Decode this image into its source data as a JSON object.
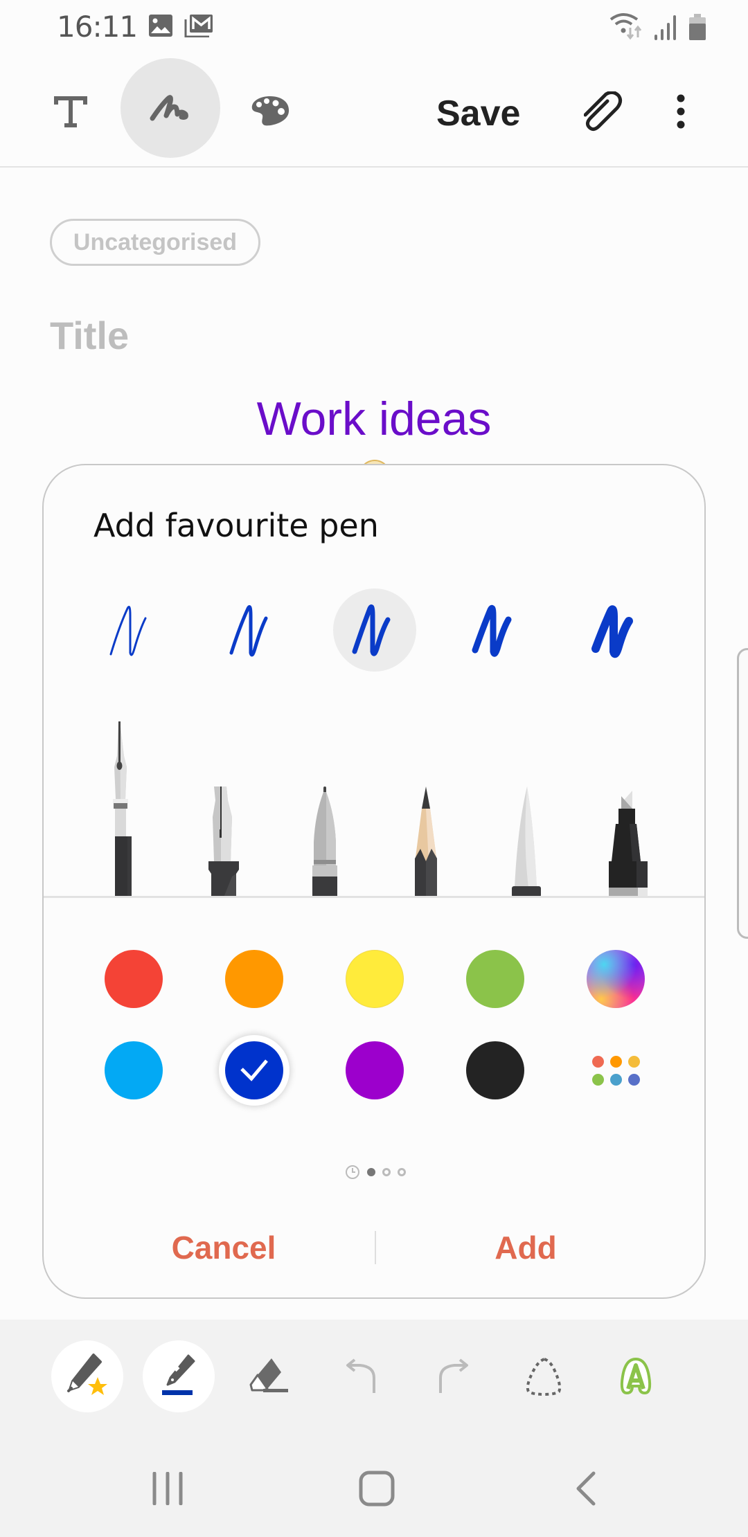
{
  "status_bar": {
    "time": "16:11",
    "left_icons": [
      "gallery-icon",
      "gmail-icon"
    ],
    "right_icons": [
      "wifi-icon",
      "signal-icon",
      "battery-icon"
    ]
  },
  "toolbar": {
    "text_mode_icon": "text-mode-icon",
    "handwriting_mode_icon": "handwriting-mode-icon",
    "handwriting_mode_active": true,
    "palette_icon": "palette-icon",
    "save_label": "Save",
    "attach_icon": "paperclip-icon",
    "more_icon": "more-vertical-icon"
  },
  "note": {
    "category_label": "Uncategorised",
    "title_placeholder": "Title",
    "handwritten_text": "Work ideas",
    "handwritten_color": "#6a0dc9"
  },
  "dialog": {
    "title": "Add favourite pen",
    "thickness_options": [
      {
        "level": 1,
        "selected": false
      },
      {
        "level": 2,
        "selected": false
      },
      {
        "level": 3,
        "selected": true
      },
      {
        "level": 4,
        "selected": false
      },
      {
        "level": 5,
        "selected": false
      }
    ],
    "pen_types": [
      "fountain-pen",
      "calligraphy-pen",
      "brush-pen",
      "pencil",
      "calligraphy-brush",
      "marker"
    ],
    "colors_row1": [
      {
        "name": "red",
        "hex": "#f44336"
      },
      {
        "name": "orange",
        "hex": "#ff9800"
      },
      {
        "name": "yellow",
        "hex": "#ffeb3b"
      },
      {
        "name": "green",
        "hex": "#8bc34a"
      },
      {
        "name": "custom-spectrum",
        "hex": "gradient"
      }
    ],
    "colors_row2": [
      {
        "name": "light-blue",
        "hex": "#03a9f4"
      },
      {
        "name": "blue",
        "hex": "#0033cc",
        "selected": true
      },
      {
        "name": "purple",
        "hex": "#9c00cc"
      },
      {
        "name": "black",
        "hex": "#232323"
      },
      {
        "name": "more-colors",
        "hex": "palette"
      }
    ],
    "pager": {
      "pages": 3,
      "current": 1,
      "has_recent_tab": true
    },
    "cancel_label": "Cancel",
    "add_label": "Add",
    "action_color": "#e0694f"
  },
  "pen_toolbar": {
    "items": [
      "favourite-pens-icon",
      "pen-settings-icon",
      "eraser-icon",
      "undo-icon",
      "redo-icon",
      "selection-lasso-icon",
      "text-recognition-icon"
    ],
    "current_pen_color": "#0033aa"
  },
  "nav_bar": {
    "items": [
      "recent-apps-icon",
      "home-icon",
      "back-icon"
    ]
  }
}
